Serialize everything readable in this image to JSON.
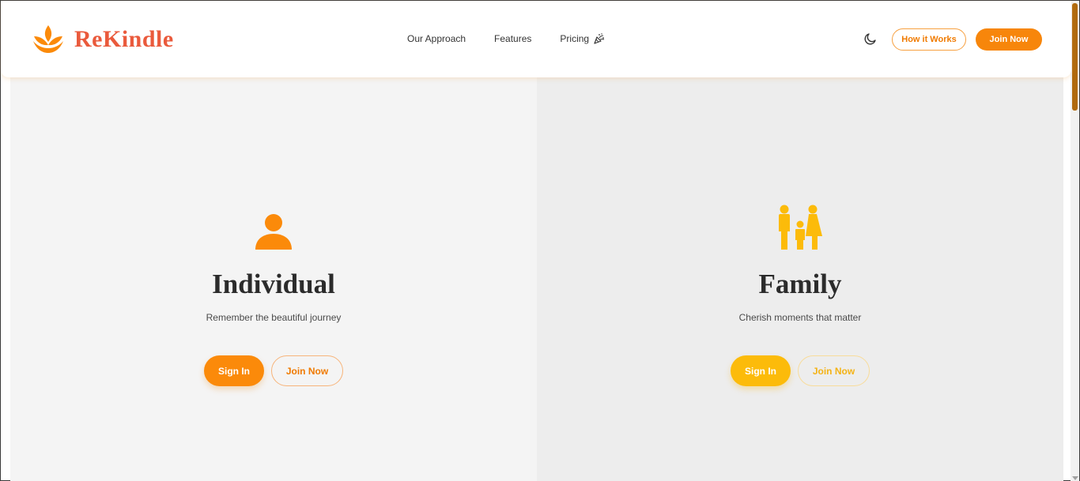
{
  "brand": {
    "name": "ReKindle",
    "color": "#ea5a3c",
    "logo_icon": "flame-leaf-icon"
  },
  "nav": {
    "items": [
      {
        "label": "Our Approach"
      },
      {
        "label": "Features"
      },
      {
        "label": "Pricing",
        "icon": "party-popper-icon"
      }
    ]
  },
  "header_actions": {
    "theme_icon": "moon-icon",
    "how_it_works": "How it Works",
    "join_now": "Join Now"
  },
  "panels": {
    "individual": {
      "icon": "person-icon",
      "title": "Individual",
      "subtitle": "Remember the beautiful journey",
      "sign_in": "Sign In",
      "join_now": "Join Now",
      "accent": "#fb8a0a"
    },
    "family": {
      "icon": "family-icon",
      "title": "Family",
      "subtitle": "Cherish moments that matter",
      "sign_in": "Sign In",
      "join_now": "Join Now",
      "accent": "#fcbb0a"
    }
  },
  "colors": {
    "primary_orange": "#f7860b",
    "secondary_yellow": "#fcbb0a",
    "left_panel_bg": "#f4f4f4",
    "right_panel_bg": "#ededed"
  }
}
